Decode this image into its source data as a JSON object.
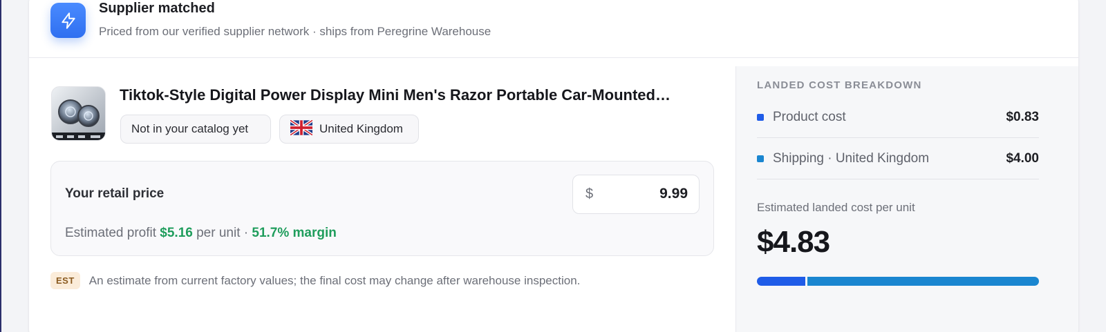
{
  "header": {
    "title": "Supplier matched",
    "subtitle": "Priced from our verified supplier network · ships from Peregrine Warehouse",
    "icon": "lightning-icon"
  },
  "product": {
    "title": "Tiktok-Style Digital Power Display Mini Men's Razor Portable Car-Mounted…",
    "catalog_status": "Not in your catalog yet",
    "country": "United Kingdom",
    "country_flag": "uk-flag-icon"
  },
  "retail": {
    "label": "Your retail price",
    "currency": "$",
    "price": "9.99",
    "profit_prefix": "Estimated profit",
    "profit_value": "$5.16",
    "profit_mid": "per unit ·",
    "margin": "51.7% margin"
  },
  "estimate_note": {
    "badge": "EST",
    "text": "An estimate from current factory values; the final cost may change after warehouse inspection."
  },
  "breakdown": {
    "heading": "LANDED COST BREAKDOWN",
    "items": [
      {
        "label": "Product cost",
        "value": "$0.83",
        "color": "#1f5ce8",
        "amount": 0.83
      },
      {
        "label": "Shipping · United Kingdom",
        "value": "$4.00",
        "color": "#1a86d0",
        "amount": 4.0
      }
    ],
    "landed_label": "Estimated landed cost per unit",
    "landed_value": "$4.83"
  },
  "colors": {
    "accent": "#2f6ff0",
    "profit_green": "#1f9d5c",
    "est_badge_bg": "#fbecd9"
  }
}
